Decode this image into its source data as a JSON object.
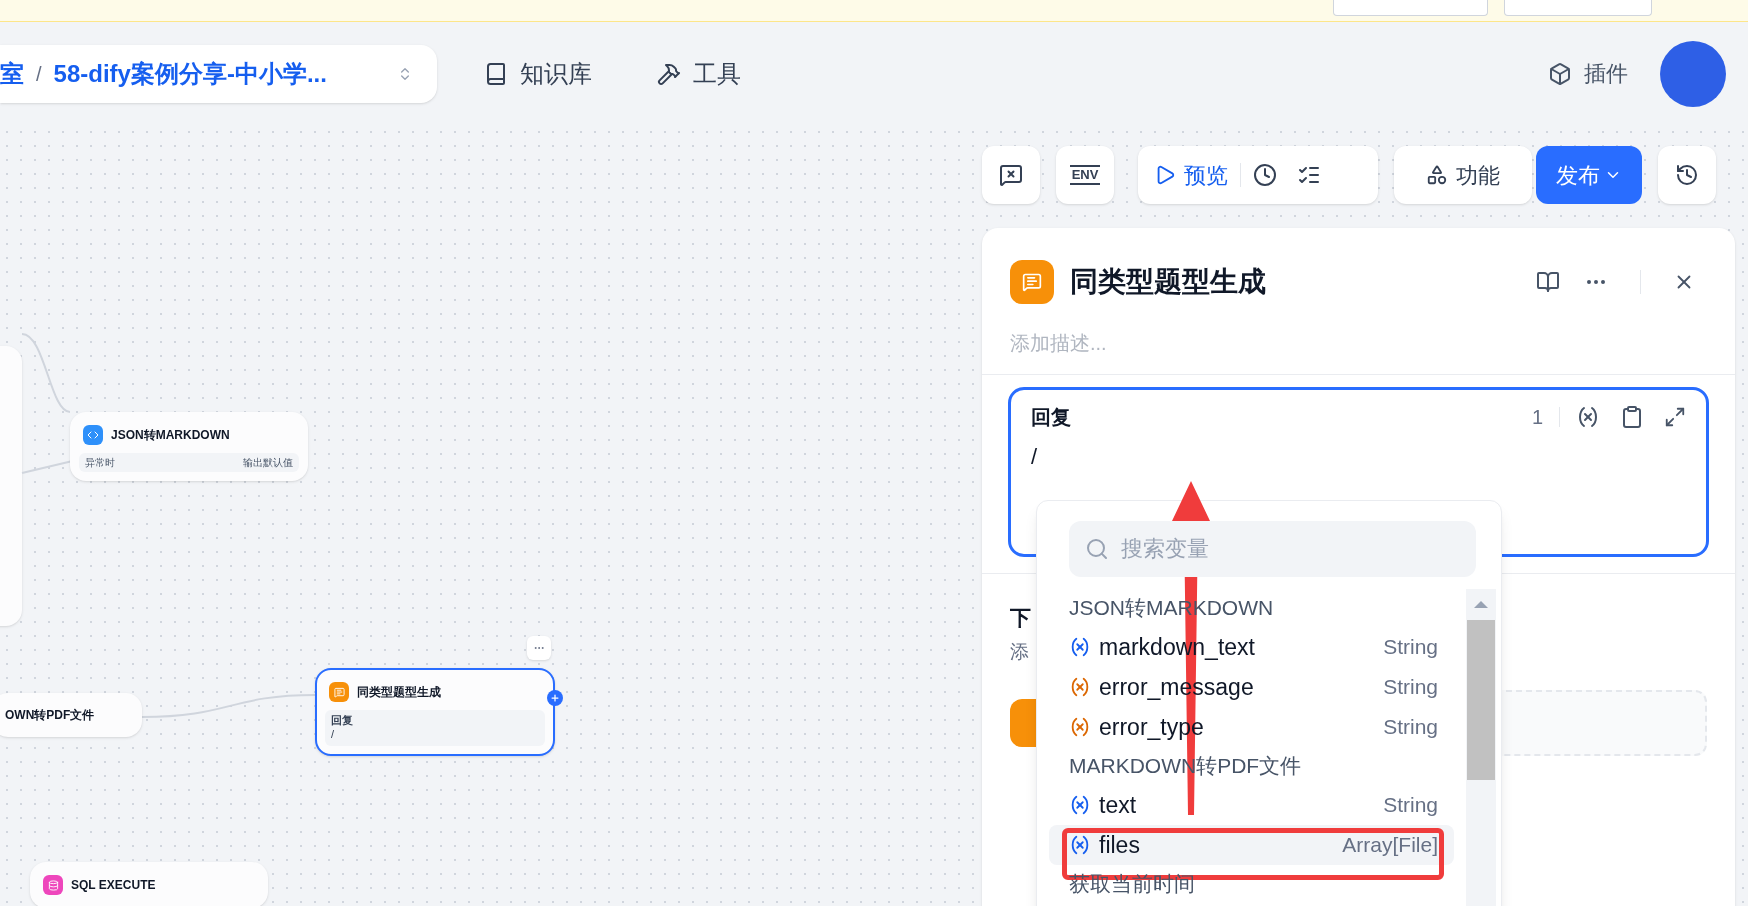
{
  "breadcrumb": {
    "items": [
      "室",
      "58-dify案例分享-中小学..."
    ],
    "separator": "/"
  },
  "nav": [
    {
      "label": "知识库",
      "kind": "knowledge"
    },
    {
      "label": "工具",
      "kind": "tools"
    }
  ],
  "plugins": {
    "label": "插件"
  },
  "toolbar": {
    "env": "ENV",
    "preview": "预览",
    "features": "功能",
    "publish": "发布"
  },
  "canvas": {
    "nodes": [
      {
        "kind": "code",
        "title": "JSON转MARKDOWN",
        "selected": false,
        "footer_left": "异常时",
        "footer_right": "输出默认值"
      },
      {
        "kind": "plain",
        "title": "OWN转PDF文件",
        "selected": false
      },
      {
        "kind": "answer",
        "title": "同类型题型生成",
        "selected": true,
        "field_label": "回复",
        "field_value": "/"
      },
      {
        "kind": "sql",
        "title": "SQL EXECUTE",
        "selected": false
      }
    ]
  },
  "panel": {
    "title": "同类型题型生成",
    "description_placeholder": "添加描述...",
    "reply": {
      "label": "回复",
      "count": "1",
      "value": "/"
    },
    "next_step": {
      "title": "下",
      "hint": "添"
    }
  },
  "variable_picker": {
    "search_placeholder": "搜索变量",
    "groups": [
      {
        "title": "JSON转MARKDOWN",
        "vars": [
          {
            "name": "markdown_text",
            "type": "String",
            "color": "#155eef",
            "selected": false
          },
          {
            "name": "error_message",
            "type": "String",
            "color": "#dc6803",
            "selected": false
          },
          {
            "name": "error_type",
            "type": "String",
            "color": "#dc6803",
            "selected": false
          }
        ]
      },
      {
        "title": "MARKDOWN转PDF文件",
        "vars": [
          {
            "name": "text",
            "type": "String",
            "color": "#155eef",
            "selected": false
          },
          {
            "name": "files",
            "type": "Array[File]",
            "color": "#155eef",
            "selected": true
          }
        ]
      },
      {
        "title": "获取当前时间"
      }
    ]
  }
}
